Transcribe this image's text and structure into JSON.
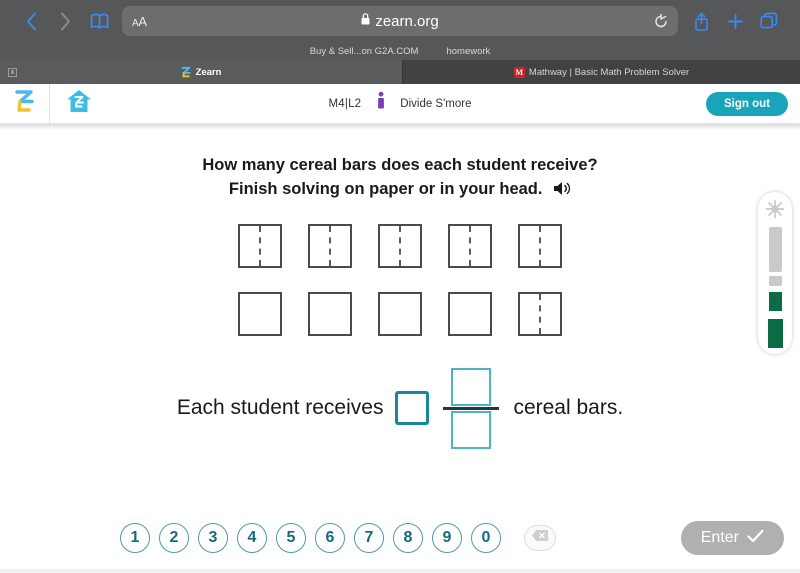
{
  "browser": {
    "back_icon": "chevron-left-icon",
    "forward_icon": "chevron-right-icon",
    "bookmarks_icon": "book-icon",
    "reader_label": "AA",
    "url": "zearn.org",
    "lock_icon": "lock-icon",
    "reload_icon": "reload-icon",
    "share_icon": "share-icon",
    "newtab_icon": "plus-icon",
    "tabs_icon": "tabs-icon",
    "favorites": [
      {
        "label": "Buy & Sell...on G2A.COM"
      },
      {
        "label": "homework"
      }
    ],
    "tabs": [
      {
        "label": "Zearn",
        "favicon": "zearn-z-icon",
        "active": true,
        "close_label": "x"
      },
      {
        "label": "Mathway | Basic Math Problem Solver",
        "favicon": "mathway-m-icon",
        "active": false,
        "favicon_letter": "M"
      }
    ]
  },
  "app_header": {
    "logo_icon": "zearn-logo-icon",
    "home_icon": "home-icon",
    "lesson_code": "M4|L2",
    "avatar_icon": "student-avatar-icon",
    "lesson_title": "Divide S'more",
    "signout_label": "Sign out",
    "accent_color": "#19a4ba"
  },
  "lesson": {
    "question_line_1": "How many cereal bars does each student receive?",
    "question_line_2": "Finish solving on paper or in your head.",
    "speaker_icon": "speaker-icon",
    "bar_rows": [
      [
        {
          "split": true
        },
        {
          "split": true
        },
        {
          "split": true
        },
        {
          "split": true
        },
        {
          "split": true
        }
      ],
      [
        {
          "split": false
        },
        {
          "split": false
        },
        {
          "split": false
        },
        {
          "split": false
        },
        {
          "split": true
        }
      ]
    ],
    "answer_prefix": "Each student receives",
    "answer_suffix": "cereal bars.",
    "whole_value": "",
    "numerator_value": "",
    "denominator_value": "",
    "whole_border_color": "#1788a0",
    "frac_border_color": "#4db4c8"
  },
  "keypad": {
    "digits": [
      "1",
      "2",
      "3",
      "4",
      "5",
      "6",
      "7",
      "8",
      "9",
      "0"
    ],
    "backspace_icon": "backspace-icon",
    "enter_label": "Enter",
    "enter_check_icon": "check-icon",
    "enter_disabled_color": "#b0b0b0",
    "digit_color": "#136b7d"
  },
  "progress": {
    "sparkle_icon": "sparkle-icon",
    "segments": [
      {
        "state": "empty"
      },
      {
        "state": "empty"
      },
      {
        "state": "filled"
      },
      {
        "state": "filled"
      }
    ],
    "filled_color": "#0b6b43",
    "empty_color": "#c9c9c9"
  }
}
